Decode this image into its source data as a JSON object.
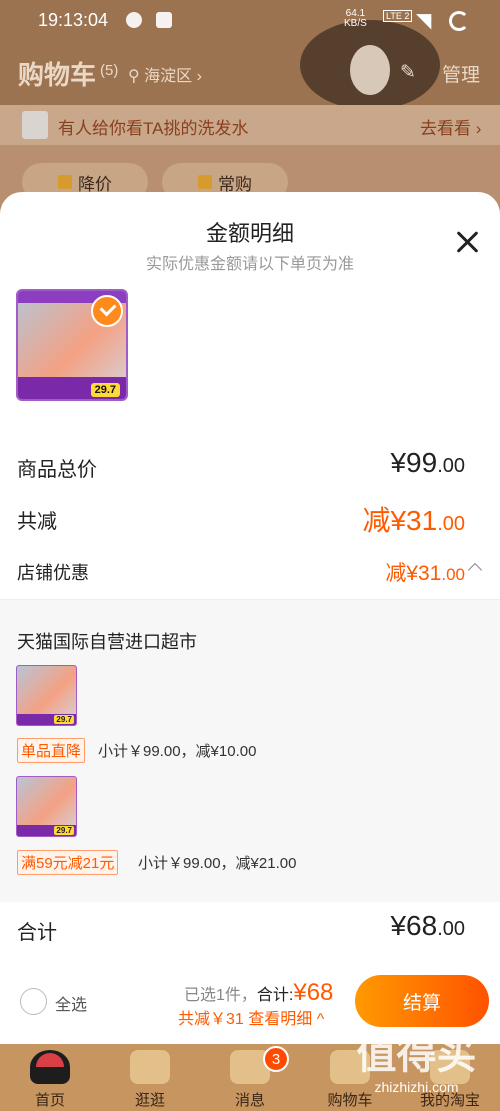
{
  "status": {
    "time": "19:13:04",
    "speed": "64.1",
    "speed_unit": "KB/S",
    "network": "LTE 2"
  },
  "header": {
    "title": "购物车",
    "count": "(5)",
    "location": "海淀区 ›",
    "manage": "管理"
  },
  "banner": {
    "text": "有人给你看TA挑的洗发水",
    "action": "去看看 ›"
  },
  "filters": [
    {
      "label": "降价"
    },
    {
      "label": "常购"
    }
  ],
  "sheet": {
    "title": "金额明细",
    "subtitle": "实际优惠金额请以下单页为准",
    "product_price_tag": "29.7",
    "rows": {
      "total": {
        "label": "商品总价",
        "currency": "¥",
        "int": "99",
        "dec": ".00"
      },
      "reduce": {
        "label": "共减",
        "prefix": "减¥",
        "int": "31",
        "dec": ".00"
      },
      "store": {
        "label": "店铺优惠",
        "prefix": "减¥",
        "int": "31",
        "dec": ".00"
      }
    },
    "detail": {
      "shop": "天猫国际自营进口超市",
      "items": [
        {
          "price_tag": "29.7",
          "tag": "单品直降",
          "desc": "小计￥99.00，减¥10.00"
        },
        {
          "price_tag": "29.7",
          "tag": "满59元减21元",
          "desc": "小计￥99.00，减¥21.00"
        }
      ]
    },
    "sum": {
      "label": "合计",
      "currency": "¥",
      "int": "68",
      "dec": ".00"
    }
  },
  "actionbar": {
    "select_all": "全选",
    "selected": "已选1件，",
    "total_label": "合计:",
    "total_amount": "¥68",
    "reduce_link": "共减￥31  查看明细 ^",
    "checkout": "结算"
  },
  "tabbar": {
    "tabs": [
      {
        "label": "首页"
      },
      {
        "label": "逛逛"
      },
      {
        "label": "消息"
      },
      {
        "label": "购物车"
      },
      {
        "label": "我的淘宝"
      }
    ],
    "message_badge": "3"
  },
  "watermark": {
    "text": "值得买",
    "url": "zhizhizhi.com"
  },
  "colors": {
    "accent": "#ff5a00",
    "checkout_start": "#ff9a00",
    "checkout_end": "#ff5200",
    "tabbar": "#c7955f"
  }
}
